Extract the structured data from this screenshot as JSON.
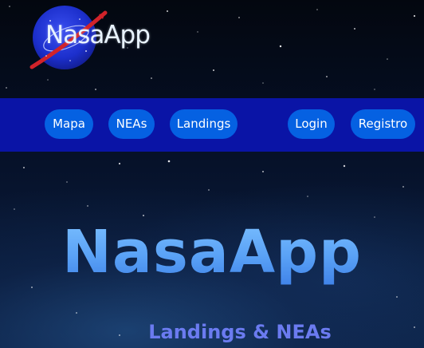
{
  "header": {
    "logo_text": "NasaApp"
  },
  "nav": {
    "left_items": [
      {
        "label": "Mapa"
      },
      {
        "label": "NEAs"
      },
      {
        "label": "Landings"
      }
    ],
    "right_items": [
      {
        "label": "Login"
      },
      {
        "label": "Registro"
      }
    ]
  },
  "hero": {
    "title": "NasaApp",
    "subtitle": "Landings & NEAs"
  },
  "colors": {
    "nav_bar": "#0a14a6",
    "nav_button": "#0561e2",
    "hero_title": "#5aa0f5",
    "hero_subtitle": "#6b7bf0"
  },
  "icons": {
    "logo": "nasa-meatball-icon"
  }
}
